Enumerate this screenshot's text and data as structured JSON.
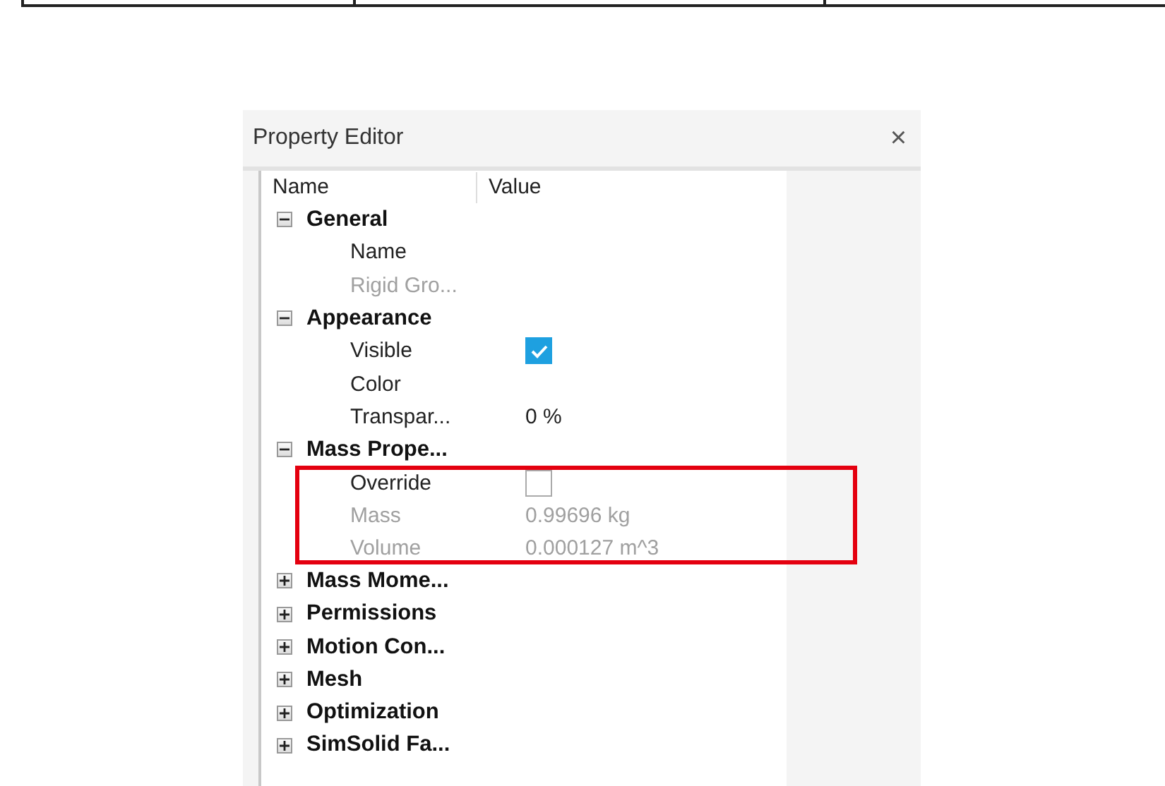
{
  "panel": {
    "title": "Property Editor",
    "close": "×"
  },
  "columns": [
    "Name",
    "Value"
  ],
  "groups": [
    {
      "label": "General",
      "expanded": true,
      "children": [
        {
          "label": "Name",
          "kind": "text",
          "disabled": false
        },
        {
          "label": "Rigid Gro...",
          "kind": "text",
          "disabled": true
        }
      ]
    },
    {
      "label": "Appearance",
      "expanded": true,
      "children": [
        {
          "label": "Visible",
          "kind": "checkbox",
          "checked": true,
          "disabled": false
        },
        {
          "label": "Color",
          "kind": "text",
          "disabled": false
        },
        {
          "label": "Transpar...",
          "kind": "text",
          "value": "0 %",
          "disabled": false
        }
      ]
    },
    {
      "label": "Mass Prope...",
      "expanded": true,
      "highlight": true,
      "children": [
        {
          "label": "Override",
          "kind": "checkbox",
          "checked": false,
          "disabled": false
        },
        {
          "label": "Mass",
          "kind": "text",
          "value": "0.99696 kg",
          "disabled": true
        },
        {
          "label": "Volume",
          "kind": "text",
          "value": "0.000127 m^3",
          "disabled": true
        }
      ]
    },
    {
      "label": "Mass Mome...",
      "expanded": false
    },
    {
      "label": "Permissions",
      "expanded": false
    },
    {
      "label": "Motion Con...",
      "expanded": false
    },
    {
      "label": "Mesh",
      "expanded": false
    },
    {
      "label": "Optimization",
      "expanded": false
    },
    {
      "label": "SimSolid Fa...",
      "expanded": false
    }
  ]
}
